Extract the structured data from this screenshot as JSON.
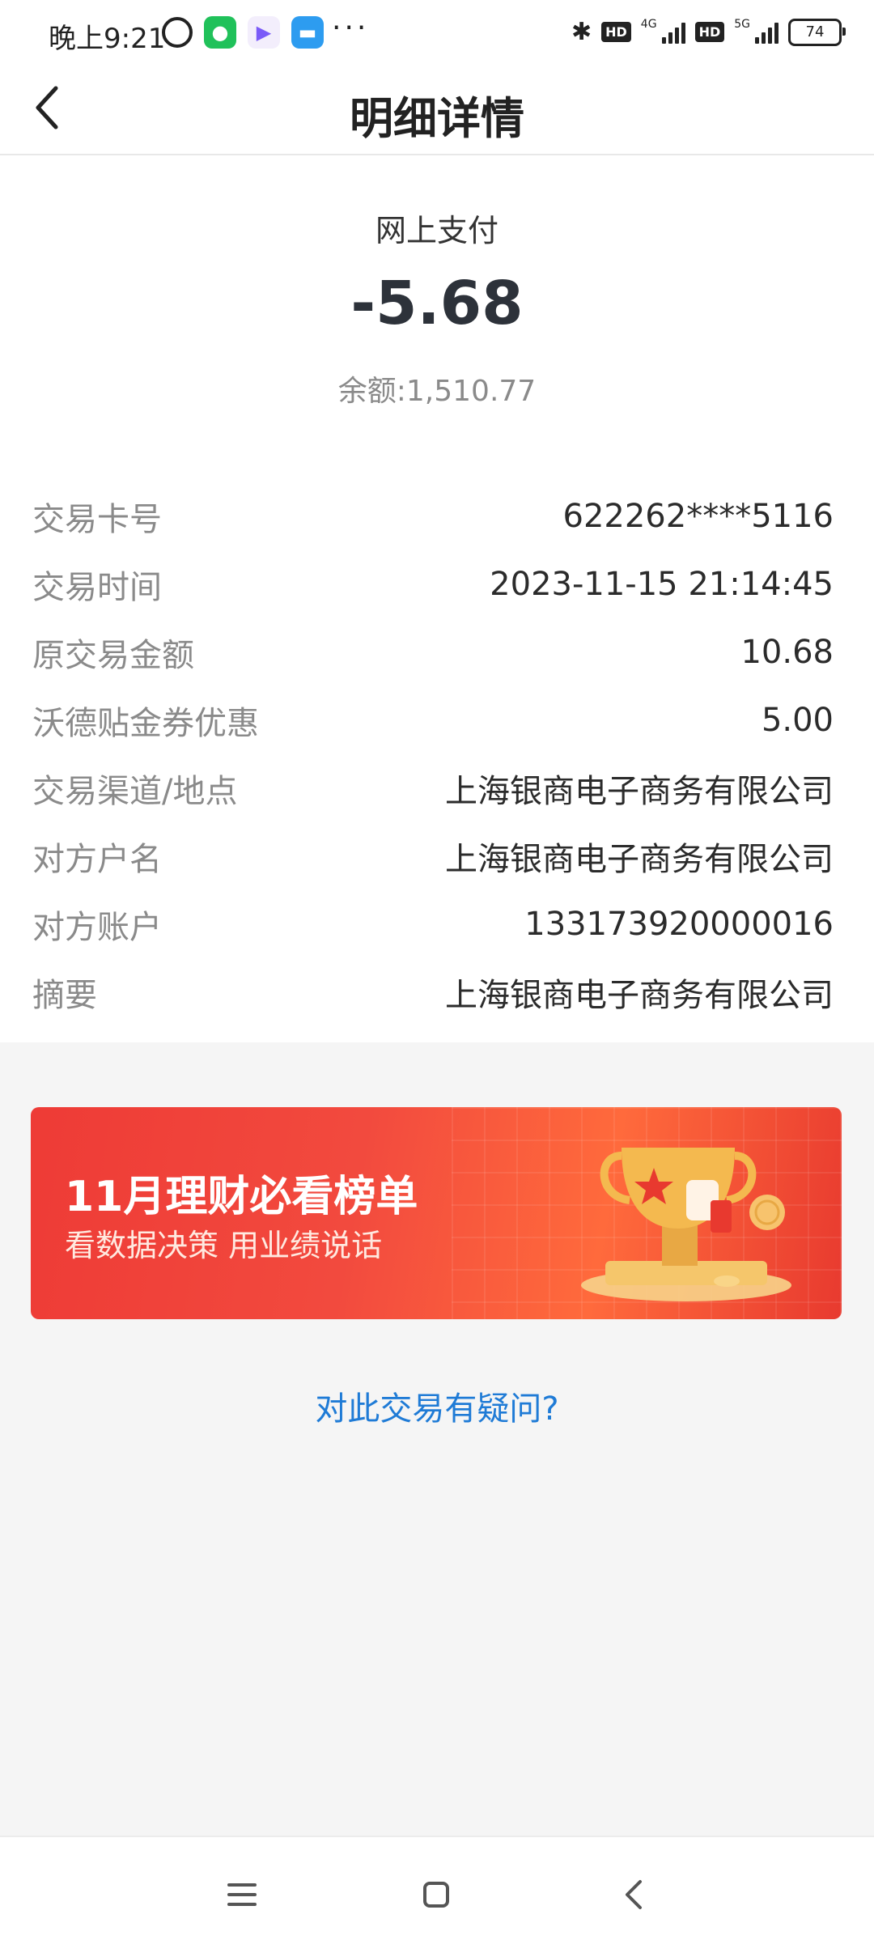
{
  "status_bar": {
    "time": "晚上9:21",
    "more": "···",
    "network_1": "4G",
    "network_2": "5G",
    "hd_1": "HD",
    "hd_2": "HD",
    "battery": "74"
  },
  "nav": {
    "title": "明细详情",
    "back_icon": "chevron-left-icon"
  },
  "summary": {
    "type": "网上支付",
    "amount": "-5.68",
    "balance": "余额:1,510.77"
  },
  "details": [
    {
      "label": "交易卡号",
      "value": "622262****5116"
    },
    {
      "label": "交易时间",
      "value": "2023-11-15 21:14:45"
    },
    {
      "label": "原交易金额",
      "value": "10.68"
    },
    {
      "label": "沃德贴金券优惠",
      "value": "5.00"
    },
    {
      "label": "交易渠道/地点",
      "value": "上海银商电子商务有限公司"
    },
    {
      "label": "对方户名",
      "value": "上海银商电子商务有限公司"
    },
    {
      "label": "对方账户",
      "value": "133173920000016"
    },
    {
      "label": "摘要",
      "value": "上海银商电子商务有限公司"
    }
  ],
  "banner": {
    "title": "11月理财必看榜单",
    "subtitle": "看数据决策 用业绩说话",
    "illustration_icon": "trophy-icon"
  },
  "inquiry_link": "对此交易有疑问?",
  "colors": {
    "link_blue": "#1f7bd6",
    "banner_red": "#ee3b36",
    "amount_dark": "#2d323a"
  }
}
